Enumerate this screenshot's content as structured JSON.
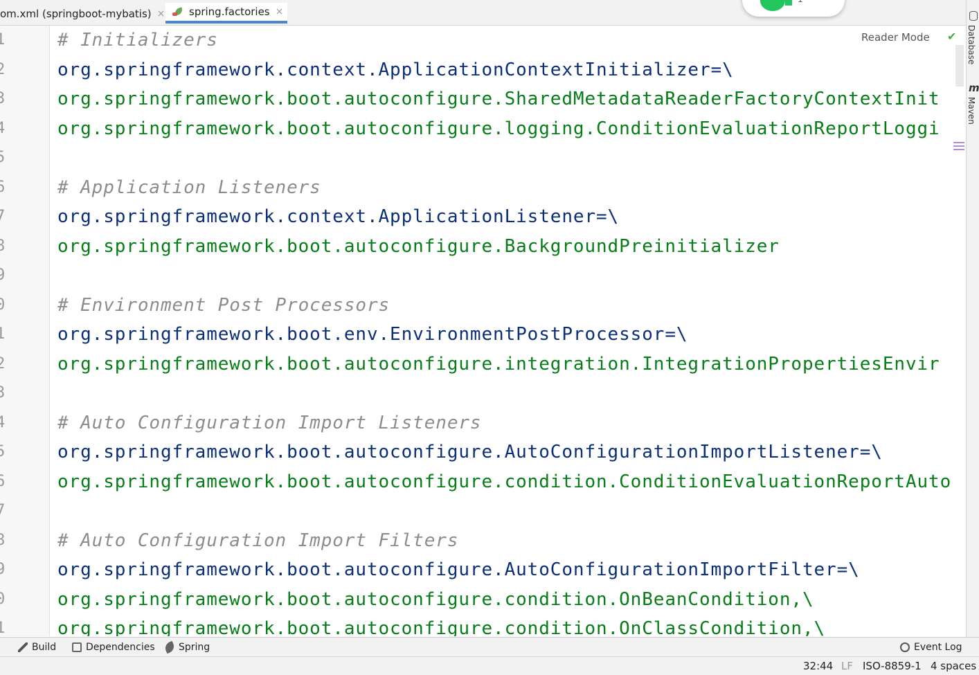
{
  "tabs": [
    {
      "label": "om.xml (springboot-mybatis)",
      "active": false
    },
    {
      "label": "spring.factories",
      "active": true
    }
  ],
  "close_glyph": "×",
  "floating_widget": {
    "count": "1"
  },
  "editor": {
    "reader_mode": "Reader Mode",
    "line_numbers": [
      "1",
      "2",
      "3",
      "4",
      "5",
      "6",
      "7",
      "8",
      "9",
      "0",
      "1",
      "2",
      "3",
      "4",
      "5",
      "6",
      "7",
      "8",
      "9",
      "0",
      "1"
    ],
    "lines": [
      {
        "type": "comment",
        "text": "# Initializers"
      },
      {
        "type": "key",
        "text": "org.springframework.context.ApplicationContextInitializer=\\"
      },
      {
        "type": "val",
        "text": "org.springframework.boot.autoconfigure.SharedMetadataReaderFactoryContextInit"
      },
      {
        "type": "val",
        "text": "org.springframework.boot.autoconfigure.logging.ConditionEvaluationReportLoggi"
      },
      {
        "type": "blank",
        "text": ""
      },
      {
        "type": "comment",
        "text": "# Application Listeners"
      },
      {
        "type": "key",
        "text": "org.springframework.context.ApplicationListener=\\"
      },
      {
        "type": "val",
        "text": "org.springframework.boot.autoconfigure.BackgroundPreinitializer"
      },
      {
        "type": "blank",
        "text": ""
      },
      {
        "type": "comment",
        "text": "# Environment Post Processors"
      },
      {
        "type": "key",
        "text": "org.springframework.boot.env.EnvironmentPostProcessor=\\"
      },
      {
        "type": "val",
        "text": "org.springframework.boot.autoconfigure.integration.IntegrationPropertiesEnvir"
      },
      {
        "type": "blank",
        "text": ""
      },
      {
        "type": "comment",
        "text": "# Auto Configuration Import Listeners"
      },
      {
        "type": "key",
        "text": "org.springframework.boot.autoconfigure.AutoConfigurationImportListener=\\"
      },
      {
        "type": "val",
        "text": "org.springframework.boot.autoconfigure.condition.ConditionEvaluationReportAuto"
      },
      {
        "type": "blank",
        "text": ""
      },
      {
        "type": "comment",
        "text": "# Auto Configuration Import Filters"
      },
      {
        "type": "key",
        "text": "org.springframework.boot.autoconfigure.AutoConfigurationImportFilter=\\"
      },
      {
        "type": "val",
        "text": "org.springframework.boot.autoconfigure.condition.OnBeanCondition,\\"
      },
      {
        "type": "val",
        "text": "org.springframework.boot.autoconfigure.condition.OnClassCondition,\\"
      }
    ]
  },
  "right_sidebar": {
    "database": "Database",
    "maven": "Maven",
    "maven_icon": "m"
  },
  "tool_windows": {
    "build": "Build",
    "dependencies": "Dependencies",
    "spring": "Spring",
    "event_log": "Event Log"
  },
  "status": {
    "position": "32:44",
    "line_sep": "LF",
    "encoding": "ISO-8859-1",
    "indent": "4 spaces"
  },
  "colors": {
    "comment": "#8c8c8c",
    "key": "#0b2e78",
    "value": "#067d17",
    "accent": "#4a88c7"
  }
}
